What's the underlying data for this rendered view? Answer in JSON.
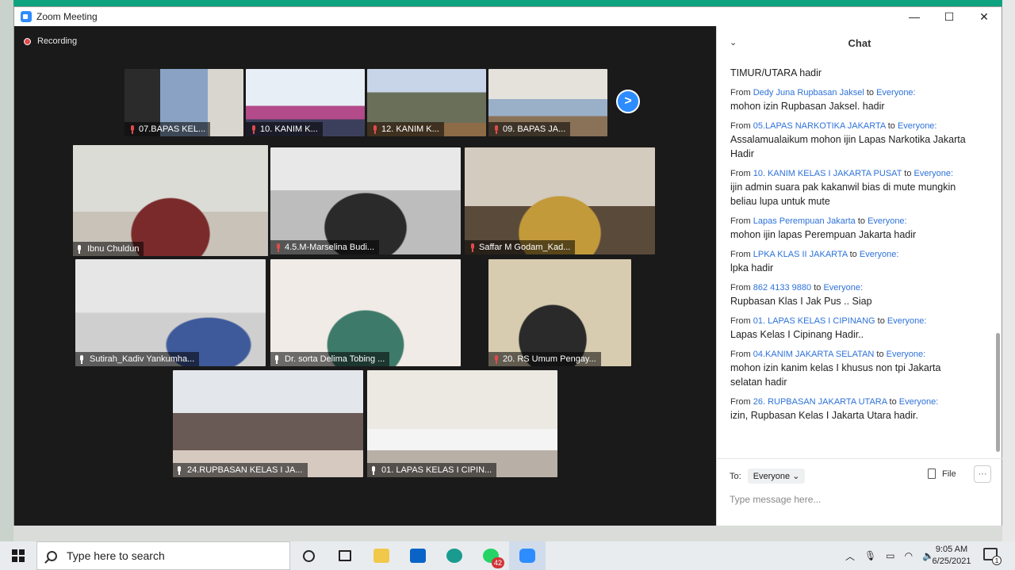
{
  "window": {
    "title": "Zoom Meeting",
    "minimize": "—",
    "maximize": "☐",
    "close": "✕"
  },
  "recording": {
    "label": "Recording"
  },
  "participants_top": [
    {
      "name": "07.BAPAS KEL...",
      "muted": true
    },
    {
      "name": "10. KANIM K...",
      "muted": true
    },
    {
      "name": "12. KANIM K...",
      "muted": true
    },
    {
      "name": "09. BAPAS JA...",
      "muted": true
    }
  ],
  "participants": [
    {
      "name": "Ibnu Chuldun",
      "muted": false
    },
    {
      "name": "4.5.M-Marselina Budi...",
      "muted": true
    },
    {
      "name": "Saffar M Godam_Kad...",
      "muted": true
    },
    {
      "name": "Sutirah_Kadiv Yankumha...",
      "muted": false
    },
    {
      "name": "Dr. sorta Delima Tobing ...",
      "muted": false
    },
    {
      "name": "20. RS Umum Pengay...",
      "muted": true
    },
    {
      "name": "24.RUPBASAN KELAS I JA...",
      "muted": false
    },
    {
      "name": "01. LAPAS KELAS I CIPIN...",
      "muted": false
    }
  ],
  "next_page": ">",
  "chat": {
    "title": "Chat",
    "first_line": "TIMUR/UTARA  hadir",
    "from_word": "From",
    "to_word": "to",
    "messages": [
      {
        "from": "Dedy Juna Rupbasan Jaksel",
        "to": "Everyone:",
        "text": "mohon izin Rupbasan Jaksel. hadir"
      },
      {
        "from": "05.LAPAS NARKOTIKA JAKARTA",
        "to": "Everyone:",
        "text": "Assalamualaikum mohon ijin Lapas Narkotika Jakarta Hadir"
      },
      {
        "from": "10. KANIM KELAS I JAKARTA PUSAT",
        "to": "Everyone:",
        "text": "ijin admin suara pak kakanwil bias di mute mungkin beliau lupa untuk mute"
      },
      {
        "from": "Lapas Perempuan Jakarta",
        "to": "Everyone:",
        "text": "mohon ijin lapas Perempuan Jakarta hadir"
      },
      {
        "from": "LPKA KLAS II JAKARTA",
        "to": "Everyone:",
        "text": "lpka hadir"
      },
      {
        "from": "862 4133 9880",
        "to": "Everyone:",
        "text": "Rupbasan Klas I Jak Pus .. Siap"
      },
      {
        "from": "01. LAPAS KELAS I CIPINANG",
        "to": "Everyone:",
        "text": "Lapas Kelas I Cipinang Hadir.."
      },
      {
        "from": "04.KANIM JAKARTA SELATAN",
        "to": "Everyone:",
        "text": "mohon izin kanim kelas I khusus non tpi Jakarta selatan hadir"
      },
      {
        "from": "26. RUPBASAN JAKARTA UTARA",
        "to": "Everyone:",
        "text": "izin, Rupbasan Kelas I Jakarta Utara hadir."
      }
    ],
    "to_label": "To:",
    "recipient": "Everyone",
    "file_label": "File",
    "more_label": "···",
    "input_placeholder": "Type message here..."
  },
  "taskbar": {
    "search_placeholder": "Type here to search",
    "whatsapp_badge": "42",
    "time": "9:05 AM",
    "date": "6/25/2021",
    "notification_count": "1"
  }
}
